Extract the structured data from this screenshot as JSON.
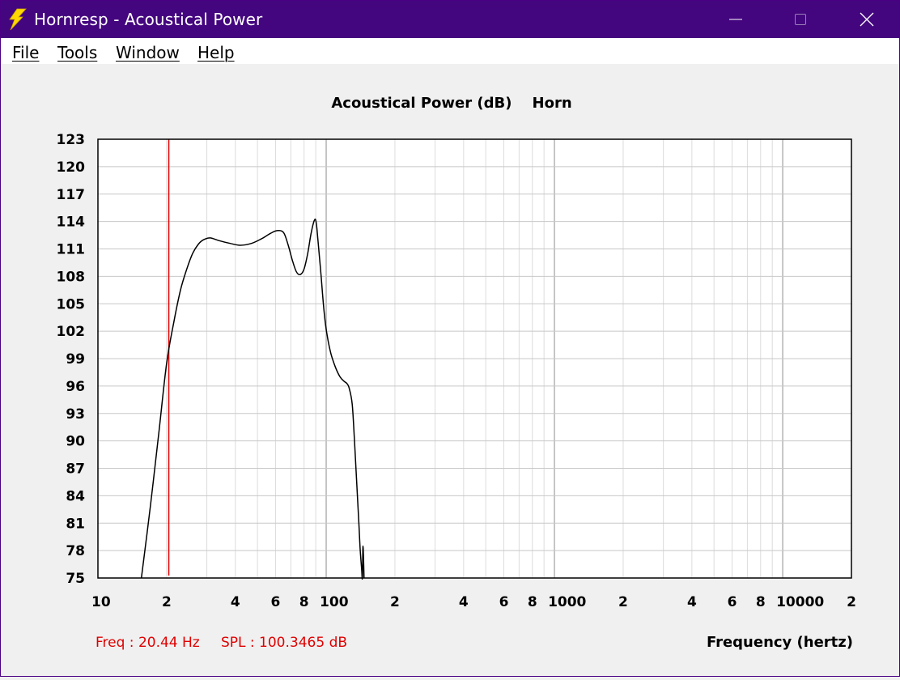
{
  "window": {
    "title": "Hornresp - Acoustical Power",
    "icon": "lightning-bolt-icon",
    "controls": [
      "minimize-icon",
      "maximize-icon",
      "close-icon"
    ]
  },
  "menu": {
    "file": "File",
    "tools": "Tools",
    "window": "Window",
    "help": "Help"
  },
  "readout": {
    "freq": "Freq : 20.44 Hz",
    "spl": "SPL : 100.3465 dB"
  },
  "colors": {
    "titlebar": "#44067f",
    "cursor": "#e00000",
    "curve": "#000000",
    "grid": "#cfcfcf"
  },
  "chart_data": {
    "type": "line",
    "title": "Acoustical Power (dB)    Horn",
    "xlabel": "Frequency (hertz)",
    "ylabel": "",
    "x_scale": "log",
    "xlim": [
      10,
      20000
    ],
    "ylim": [
      75,
      123
    ],
    "y_ticks": [
      123,
      120,
      117,
      114,
      111,
      108,
      105,
      102,
      99,
      96,
      93,
      90,
      87,
      84,
      81,
      78,
      75
    ],
    "x_tick_labels": [
      {
        "f": 10,
        "label": "10"
      },
      {
        "f": 20,
        "label": "2"
      },
      {
        "f": 40,
        "label": "4"
      },
      {
        "f": 60,
        "label": "6"
      },
      {
        "f": 80,
        "label": "8"
      },
      {
        "f": 100,
        "label": "100"
      },
      {
        "f": 200,
        "label": "2"
      },
      {
        "f": 400,
        "label": "4"
      },
      {
        "f": 600,
        "label": "6"
      },
      {
        "f": 800,
        "label": "8"
      },
      {
        "f": 1000,
        "label": "1000"
      },
      {
        "f": 2000,
        "label": "2"
      },
      {
        "f": 4000,
        "label": "4"
      },
      {
        "f": 6000,
        "label": "6"
      },
      {
        "f": 8000,
        "label": "8"
      },
      {
        "f": 10000,
        "label": "10000"
      },
      {
        "f": 20000,
        "label": "2"
      }
    ],
    "grid": true,
    "cursor": {
      "freq": 20.44,
      "spl": 100.3465
    },
    "series": [
      {
        "x": [
          15.5,
          17,
          18.5,
          20,
          21.5,
          23,
          24.5,
          26,
          27.5,
          29,
          31,
          34,
          38,
          42,
          47,
          52,
          57,
          61,
          65,
          68,
          71,
          74,
          77,
          80,
          83,
          86,
          89,
          90.5,
          92,
          95,
          98,
          101,
          105,
          110,
          115,
          120,
          123,
          126,
          130,
          133,
          135,
          137,
          139,
          141,
          143,
          144,
          145,
          146.5
        ],
        "y": [
          75,
          83,
          91,
          98.5,
          103,
          106.5,
          108.8,
          110.5,
          111.5,
          112,
          112.2,
          111.9,
          111.6,
          111.4,
          111.6,
          112.1,
          112.7,
          113,
          112.8,
          111.5,
          109.8,
          108.5,
          108.2,
          108.8,
          110.5,
          112.8,
          114.2,
          113.8,
          112,
          108,
          104,
          101.5,
          99.5,
          98,
          97,
          96.5,
          96.3,
          95.8,
          94,
          90,
          87,
          84,
          81,
          78,
          76,
          75,
          78.5,
          75
        ]
      }
    ]
  }
}
